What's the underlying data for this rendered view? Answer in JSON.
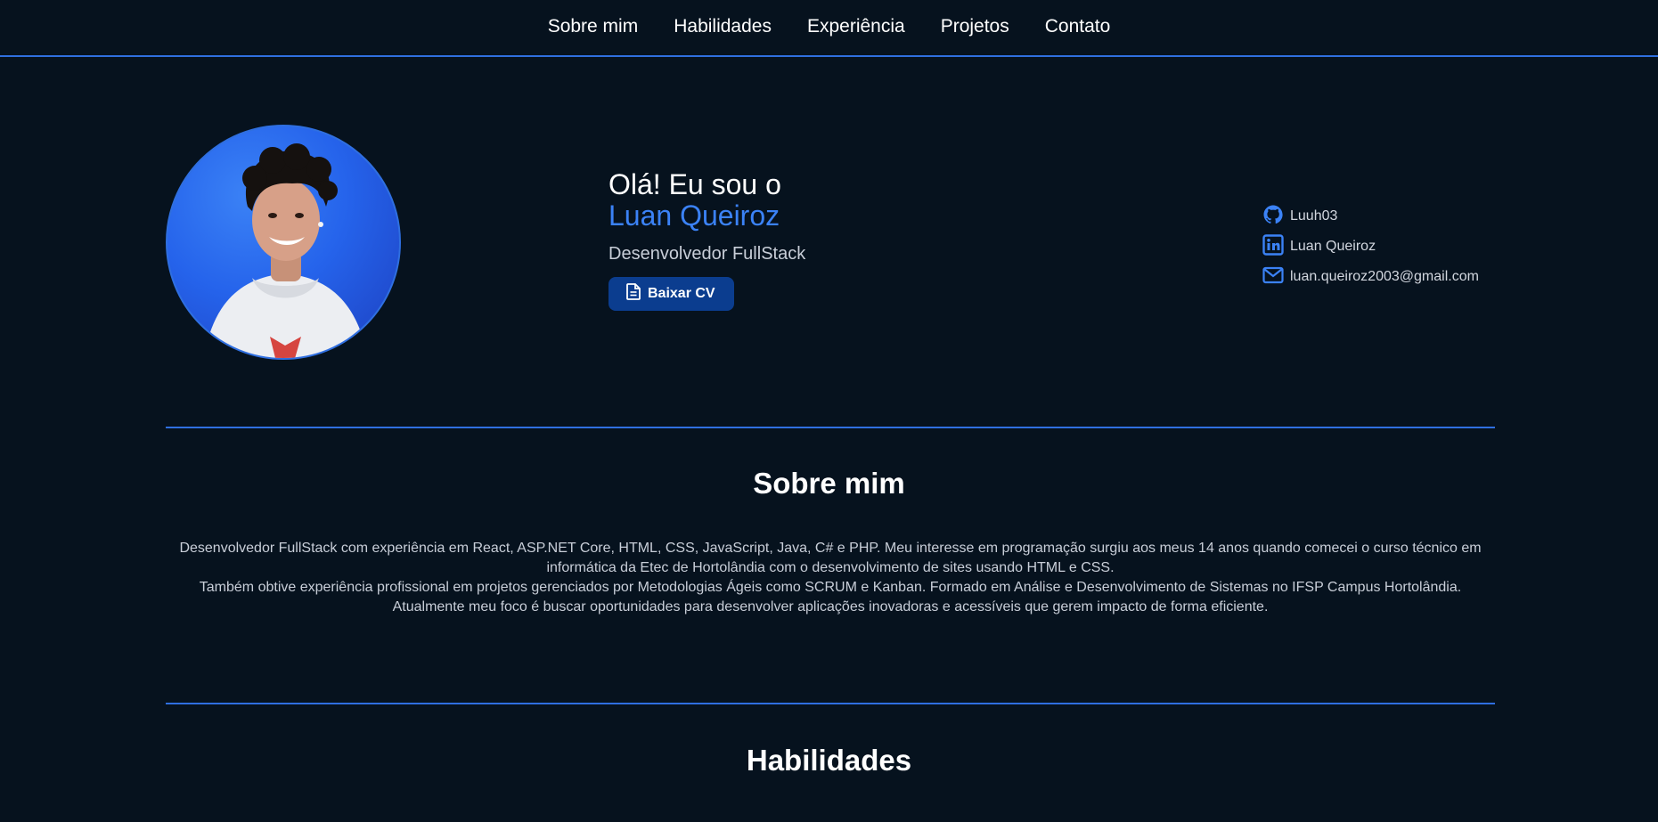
{
  "nav": {
    "items": [
      "Sobre mim",
      "Habilidades",
      "Experiência",
      "Projetos",
      "Contato"
    ]
  },
  "hero": {
    "greeting": "Olá! Eu sou o",
    "name": "Luan Queiroz",
    "role": "Desenvolvedor FullStack",
    "cv_button_label": "Baixar CV",
    "cv_icon": "file-text-icon"
  },
  "contacts": [
    {
      "icon": "github-icon",
      "label": "Luuh03"
    },
    {
      "icon": "linkedin-icon",
      "label": "Luan Queiroz"
    },
    {
      "icon": "mail-icon",
      "label": "luan.queiroz2003@gmail.com"
    }
  ],
  "about": {
    "title": "Sobre mim",
    "paragraphs": [
      "Desenvolvedor FullStack com experiência em React, ASP.NET Core, HTML, CSS, JavaScript, Java, C# e PHP. Meu interesse em programação surgiu aos meus 14 anos quando comecei o curso técnico em informática da Etec de Hortolândia com o desenvolvimento de sites usando HTML e CSS.",
      "Também obtive experiência profissional em projetos gerenciados por Metodologias Ágeis como SCRUM e Kanban. Formado em Análise e Desenvolvimento de Sistemas no IFSP Campus Hortolândia.",
      "Atualmente meu foco é buscar oportunidades para desenvolver aplicações inovadoras e acessíveis que gerem impacto de forma eficiente."
    ]
  },
  "skills": {
    "title": "Habilidades"
  },
  "colors": {
    "background": "#06121e",
    "accent": "#3b82f6",
    "divider": "#2f6fe0",
    "button": "#0b3d8f"
  }
}
